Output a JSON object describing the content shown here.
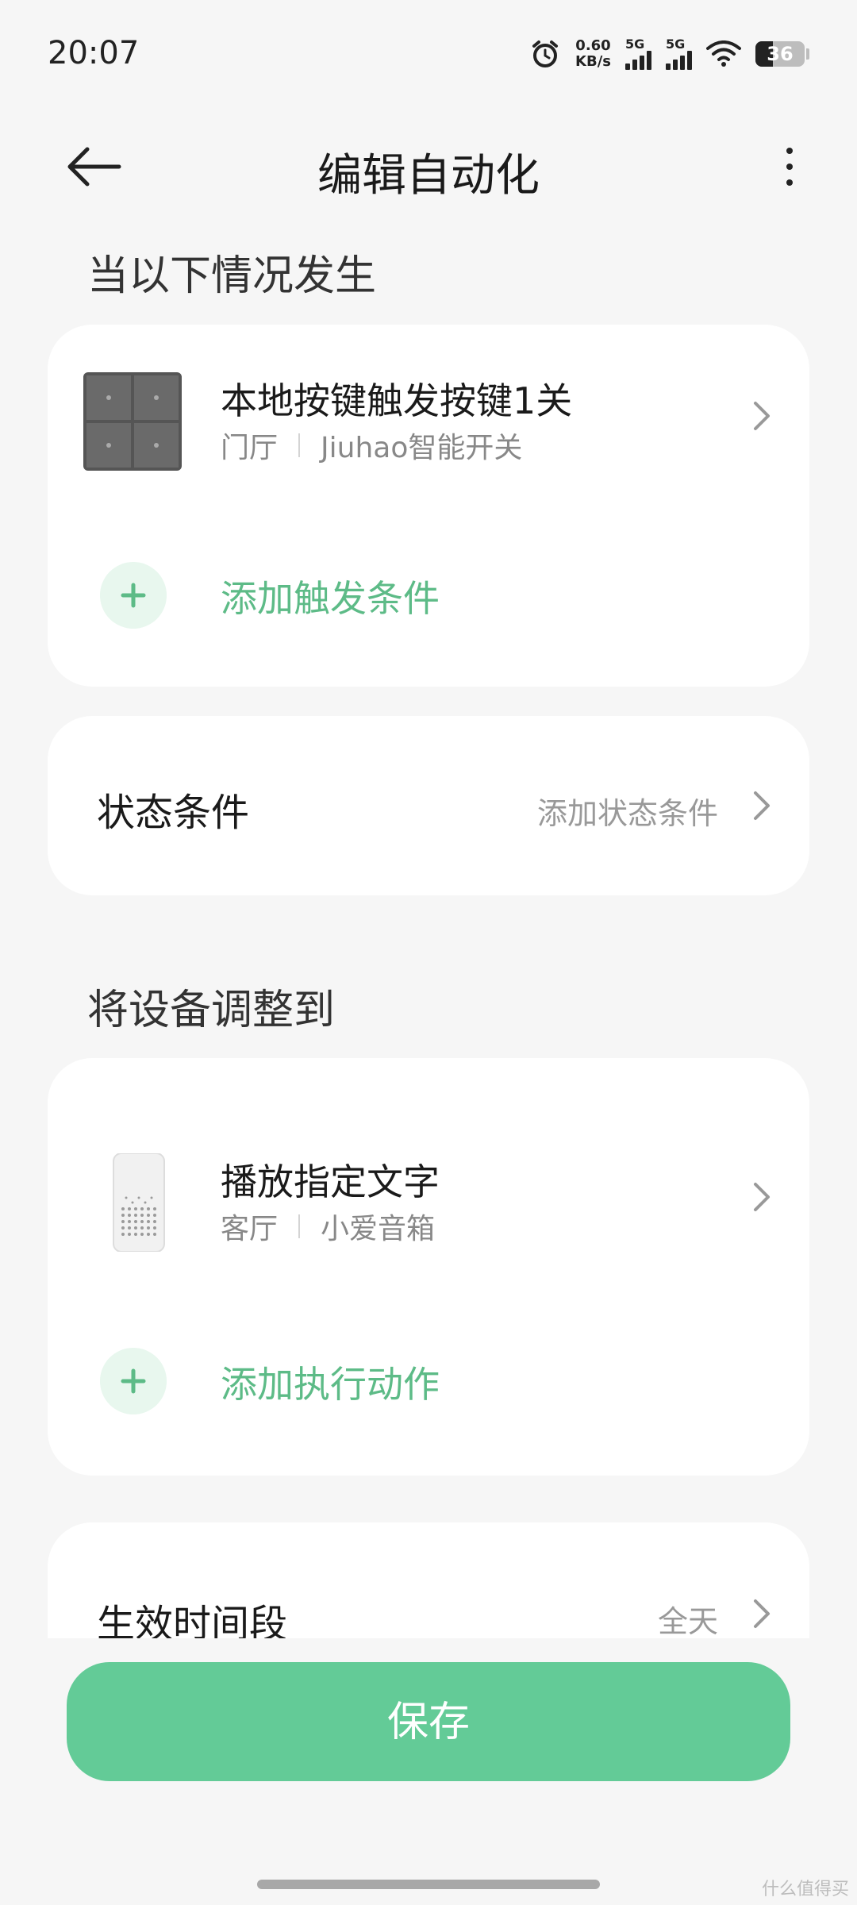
{
  "status_bar": {
    "time": "20:07",
    "net_speed_value": "0.60",
    "net_speed_unit": "KB/s",
    "sim1_label": "5G",
    "sim2_label": "5G",
    "battery_level": "36"
  },
  "header": {
    "title": "编辑自动化"
  },
  "trigger_section": {
    "title": "当以下情况发生",
    "device": {
      "name": "本地按键触发按键1关",
      "room": "门厅",
      "model": "Jiuhao智能开关"
    },
    "add_label": "添加触发条件"
  },
  "state_condition": {
    "title": "状态条件",
    "value": "添加状态条件"
  },
  "action_section": {
    "title": "将设备调整到",
    "device": {
      "name": "播放指定文字",
      "room": "客厅",
      "model": "小爱音箱"
    },
    "add_label": "添加执行动作"
  },
  "effective_period": {
    "title": "生效时间段",
    "value": "全天"
  },
  "save_button": {
    "label": "保存"
  },
  "watermark": "什么值得买",
  "colors": {
    "accent": "#63cb97",
    "accent_text": "#5dbb87",
    "background": "#f6f6f6",
    "card": "#ffffff"
  }
}
